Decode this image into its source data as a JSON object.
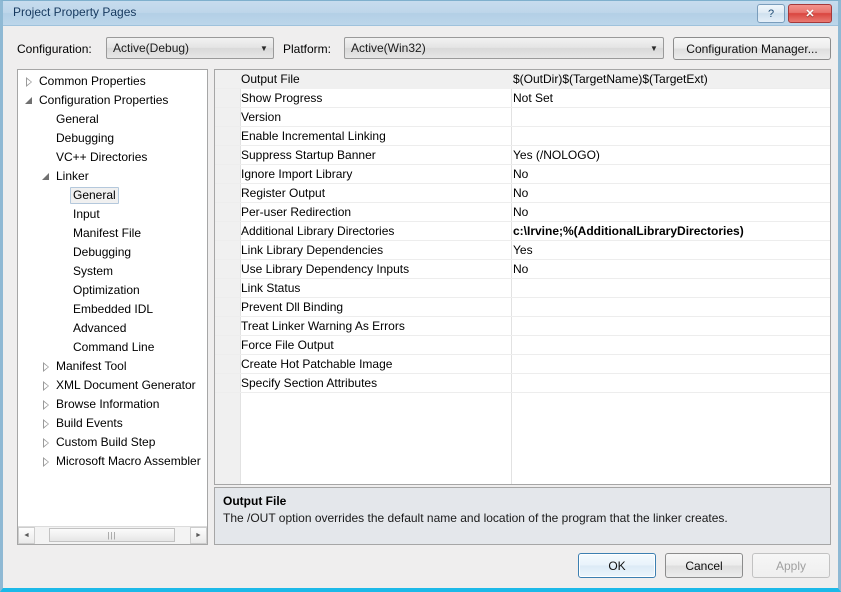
{
  "window": {
    "title": "Project Property Pages",
    "help_button": "?",
    "close_button": "✕"
  },
  "config_bar": {
    "configuration_label": "Configuration:",
    "configuration_value": "Active(Debug)",
    "platform_label": "Platform:",
    "platform_value": "Active(Win32)",
    "configuration_manager_button": "Configuration Manager..."
  },
  "tree": {
    "nodes": [
      {
        "label": "Common Properties",
        "indent": 0,
        "expander": "collapsed",
        "selected": false
      },
      {
        "label": "Configuration Properties",
        "indent": 0,
        "expander": "expanded",
        "selected": false
      },
      {
        "label": "General",
        "indent": 1,
        "expander": "none",
        "selected": false
      },
      {
        "label": "Debugging",
        "indent": 1,
        "expander": "none",
        "selected": false
      },
      {
        "label": "VC++ Directories",
        "indent": 1,
        "expander": "none",
        "selected": false
      },
      {
        "label": "Linker",
        "indent": 1,
        "expander": "expanded",
        "selected": false
      },
      {
        "label": "General",
        "indent": 2,
        "expander": "none",
        "selected": true
      },
      {
        "label": "Input",
        "indent": 2,
        "expander": "none",
        "selected": false
      },
      {
        "label": "Manifest File",
        "indent": 2,
        "expander": "none",
        "selected": false
      },
      {
        "label": "Debugging",
        "indent": 2,
        "expander": "none",
        "selected": false
      },
      {
        "label": "System",
        "indent": 2,
        "expander": "none",
        "selected": false
      },
      {
        "label": "Optimization",
        "indent": 2,
        "expander": "none",
        "selected": false
      },
      {
        "label": "Embedded IDL",
        "indent": 2,
        "expander": "none",
        "selected": false
      },
      {
        "label": "Advanced",
        "indent": 2,
        "expander": "none",
        "selected": false
      },
      {
        "label": "Command Line",
        "indent": 2,
        "expander": "none",
        "selected": false
      },
      {
        "label": "Manifest Tool",
        "indent": 1,
        "expander": "collapsed",
        "selected": false
      },
      {
        "label": "XML Document Generator",
        "indent": 1,
        "expander": "collapsed",
        "selected": false
      },
      {
        "label": "Browse Information",
        "indent": 1,
        "expander": "collapsed",
        "selected": false
      },
      {
        "label": "Build Events",
        "indent": 1,
        "expander": "collapsed",
        "selected": false
      },
      {
        "label": "Custom Build Step",
        "indent": 1,
        "expander": "collapsed",
        "selected": false
      },
      {
        "label": "Microsoft Macro Assembler",
        "indent": 1,
        "expander": "collapsed",
        "selected": false
      }
    ],
    "scrollbar": {
      "left_arrow": "◄",
      "right_arrow": "►",
      "grip": "|||"
    }
  },
  "grid": {
    "rows": [
      {
        "name": "Output File",
        "value": "$(OutDir)$(TargetName)$(TargetExt)",
        "bold": false,
        "selected": true
      },
      {
        "name": "Show Progress",
        "value": "Not Set",
        "bold": false,
        "selected": false
      },
      {
        "name": "Version",
        "value": "",
        "bold": false,
        "selected": false
      },
      {
        "name": "Enable Incremental Linking",
        "value": "",
        "bold": false,
        "selected": false
      },
      {
        "name": "Suppress Startup Banner",
        "value": "Yes (/NOLOGO)",
        "bold": false,
        "selected": false
      },
      {
        "name": "Ignore Import Library",
        "value": "No",
        "bold": false,
        "selected": false
      },
      {
        "name": "Register Output",
        "value": "No",
        "bold": false,
        "selected": false
      },
      {
        "name": "Per-user Redirection",
        "value": "No",
        "bold": false,
        "selected": false
      },
      {
        "name": "Additional Library Directories",
        "value": "c:\\Irvine;%(AdditionalLibraryDirectories)",
        "bold": true,
        "selected": false
      },
      {
        "name": "Link Library Dependencies",
        "value": "Yes",
        "bold": false,
        "selected": false
      },
      {
        "name": "Use Library Dependency Inputs",
        "value": "No",
        "bold": false,
        "selected": false
      },
      {
        "name": "Link Status",
        "value": "",
        "bold": false,
        "selected": false
      },
      {
        "name": "Prevent Dll Binding",
        "value": "",
        "bold": false,
        "selected": false
      },
      {
        "name": "Treat Linker Warning As Errors",
        "value": "",
        "bold": false,
        "selected": false
      },
      {
        "name": "Force File Output",
        "value": "",
        "bold": false,
        "selected": false
      },
      {
        "name": "Create Hot Patchable Image",
        "value": "",
        "bold": false,
        "selected": false
      },
      {
        "name": "Specify Section Attributes",
        "value": "",
        "bold": false,
        "selected": false
      }
    ]
  },
  "description": {
    "title": "Output File",
    "text": "The /OUT option overrides the default name and location of the program that the linker creates."
  },
  "footer": {
    "ok": "OK",
    "cancel": "Cancel",
    "apply": "Apply"
  }
}
